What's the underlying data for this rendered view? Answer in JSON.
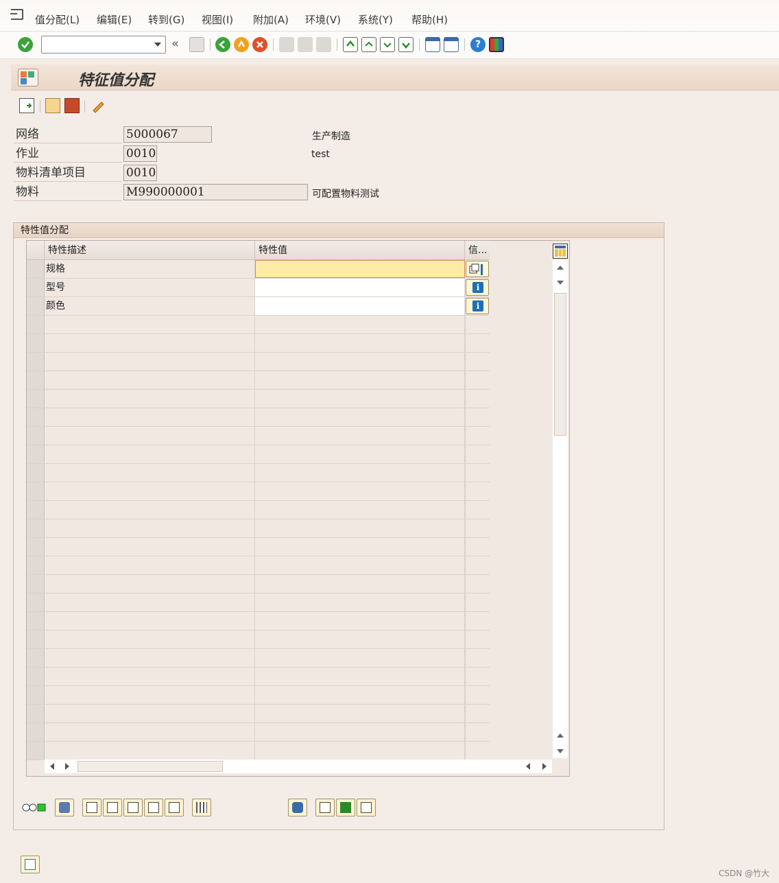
{
  "menu": {
    "items": [
      "值分配(L)",
      "编辑(E)",
      "转到(G)",
      "视图(I)",
      "附加(A)",
      "环境(V)",
      "系统(Y)",
      "帮助(H)"
    ]
  },
  "toolbar": {
    "command_field_value": "",
    "icons": [
      "enter-check-icon",
      "save-icon",
      "back-icon",
      "exit-icon",
      "cancel-icon",
      "print-icon",
      "find-icon",
      "find-next-icon",
      "first-page-icon",
      "previous-page-icon",
      "next-page-icon",
      "last-page-icon",
      "new-session-icon",
      "shortcut-icon",
      "help-icon",
      "customize-layout-icon"
    ]
  },
  "title": "特征值分配",
  "header": {
    "network_label": "网络",
    "network_value": "5000067",
    "network_desc": "生产制造",
    "activity_label": "作业",
    "activity_value": "0010",
    "activity_desc": "test",
    "bom_item_label": "物料清单项目",
    "bom_item_value": "0010",
    "material_label": "物料",
    "material_value": "M990000001",
    "material_desc": "可配置物料测试"
  },
  "group": {
    "title": "特性值分配"
  },
  "table": {
    "columns": [
      "特性描述",
      "特性值",
      "信..."
    ],
    "rows": [
      {
        "desc": "规格",
        "value": ""
      },
      {
        "desc": "型号",
        "value": ""
      },
      {
        "desc": "颜色",
        "value": ""
      }
    ]
  },
  "watermark": "CSDN @竹大",
  "colors": {
    "background": "#f4ece7",
    "active_cell": "#fdeca5",
    "info_blue": "#1e6fb7",
    "check_green": "#3aa33a"
  }
}
